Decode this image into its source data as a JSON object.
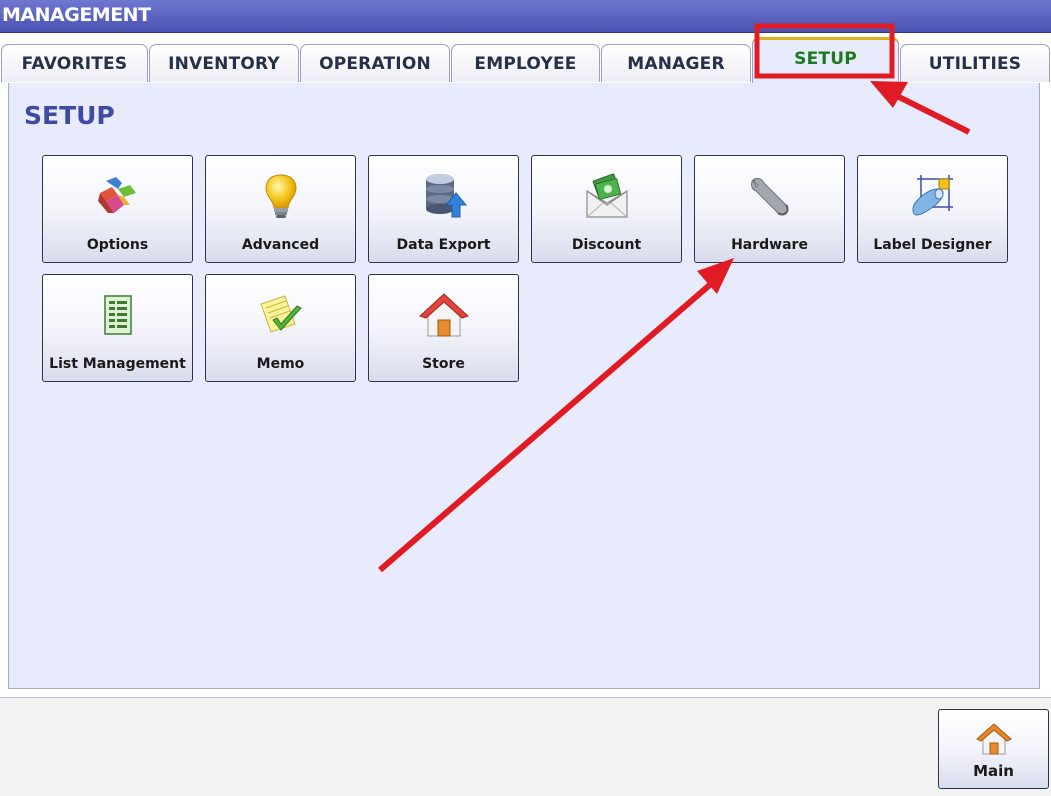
{
  "window": {
    "title": "MANAGEMENT"
  },
  "tabs": [
    {
      "label": "FAVORITES",
      "active": false
    },
    {
      "label": "INVENTORY",
      "active": false
    },
    {
      "label": "OPERATION",
      "active": false
    },
    {
      "label": "EMPLOYEE",
      "active": false
    },
    {
      "label": "MANAGER",
      "active": false
    },
    {
      "label": "SETUP",
      "active": true
    },
    {
      "label": "UTILITIES",
      "active": false
    }
  ],
  "panel": {
    "title": "SETUP",
    "tiles": [
      {
        "label": "Options",
        "icon": "puzzle-icon"
      },
      {
        "label": "Advanced",
        "icon": "lightbulb-icon"
      },
      {
        "label": "Data Export",
        "icon": "database-export-icon"
      },
      {
        "label": "Discount",
        "icon": "money-envelope-icon"
      },
      {
        "label": "Hardware",
        "icon": "wrench-icon"
      },
      {
        "label": "Label Designer",
        "icon": "label-designer-icon"
      },
      {
        "label": "List Management",
        "icon": "list-document-icon"
      },
      {
        "label": "Memo",
        "icon": "memo-check-icon"
      },
      {
        "label": "Store",
        "icon": "house-icon"
      }
    ]
  },
  "footer": {
    "main_label": "Main",
    "main_icon": "house-icon"
  },
  "colors": {
    "titlebar": "#5860c0",
    "active_tab_text": "#1c7a1c",
    "active_tab_accent": "#e3b021",
    "panel_bg": "#e8ebfb",
    "panel_title": "#3f4aa3",
    "annotation_red": "#e01b24"
  }
}
